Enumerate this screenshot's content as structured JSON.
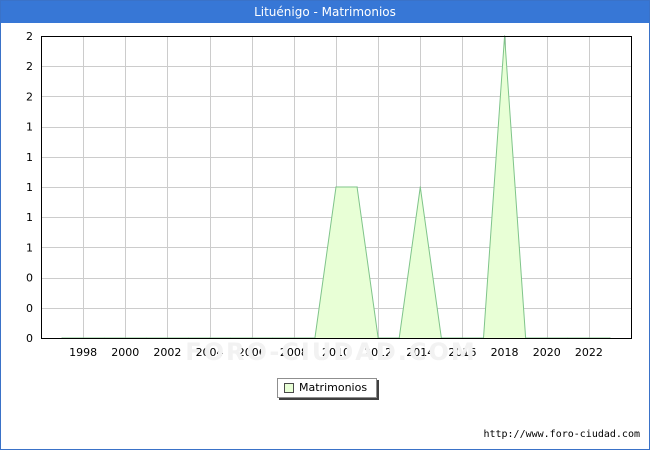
{
  "title": "Lituénigo - Matrimonios",
  "watermark": "FORO-CIUDAD.COM",
  "source_url": "http://www.foro-ciudad.com",
  "colors": {
    "title_bg": "#3777d6",
    "fill": "#e8ffd6",
    "line": "#7fc48a",
    "grid": "#cccccc"
  },
  "chart_data": {
    "type": "area",
    "title": "Lituénigo - Matrimonios",
    "xlabel": "",
    "ylabel": "",
    "xlim": [
      1996,
      2024
    ],
    "ylim": [
      0,
      2
    ],
    "x_ticks": [
      1998,
      2000,
      2002,
      2004,
      2006,
      2008,
      2010,
      2012,
      2014,
      2016,
      2018,
      2020,
      2022
    ],
    "y_ticks": [
      0,
      0.2,
      0.4,
      0.6,
      0.8,
      1,
      1.2,
      1.4,
      1.6,
      1.8,
      2
    ],
    "y_tick_labels": [
      "0",
      "0",
      "0",
      "1",
      "1",
      "1",
      "1",
      "1",
      "2",
      "2",
      "2"
    ],
    "grid": true,
    "legend_position": "bottom-center",
    "series": [
      {
        "name": "Matrimonios",
        "x": [
          1997,
          1998,
          1999,
          2000,
          2001,
          2002,
          2003,
          2004,
          2005,
          2006,
          2007,
          2008,
          2009,
          2010,
          2011,
          2012,
          2013,
          2014,
          2015,
          2016,
          2017,
          2018,
          2019,
          2020,
          2021,
          2022,
          2023
        ],
        "values": [
          0,
          0,
          0,
          0,
          0,
          0,
          0,
          0,
          0,
          0,
          0,
          0,
          0,
          1,
          1,
          0,
          0,
          1,
          0,
          0,
          0,
          2,
          0,
          0,
          0,
          0,
          0
        ]
      }
    ]
  }
}
